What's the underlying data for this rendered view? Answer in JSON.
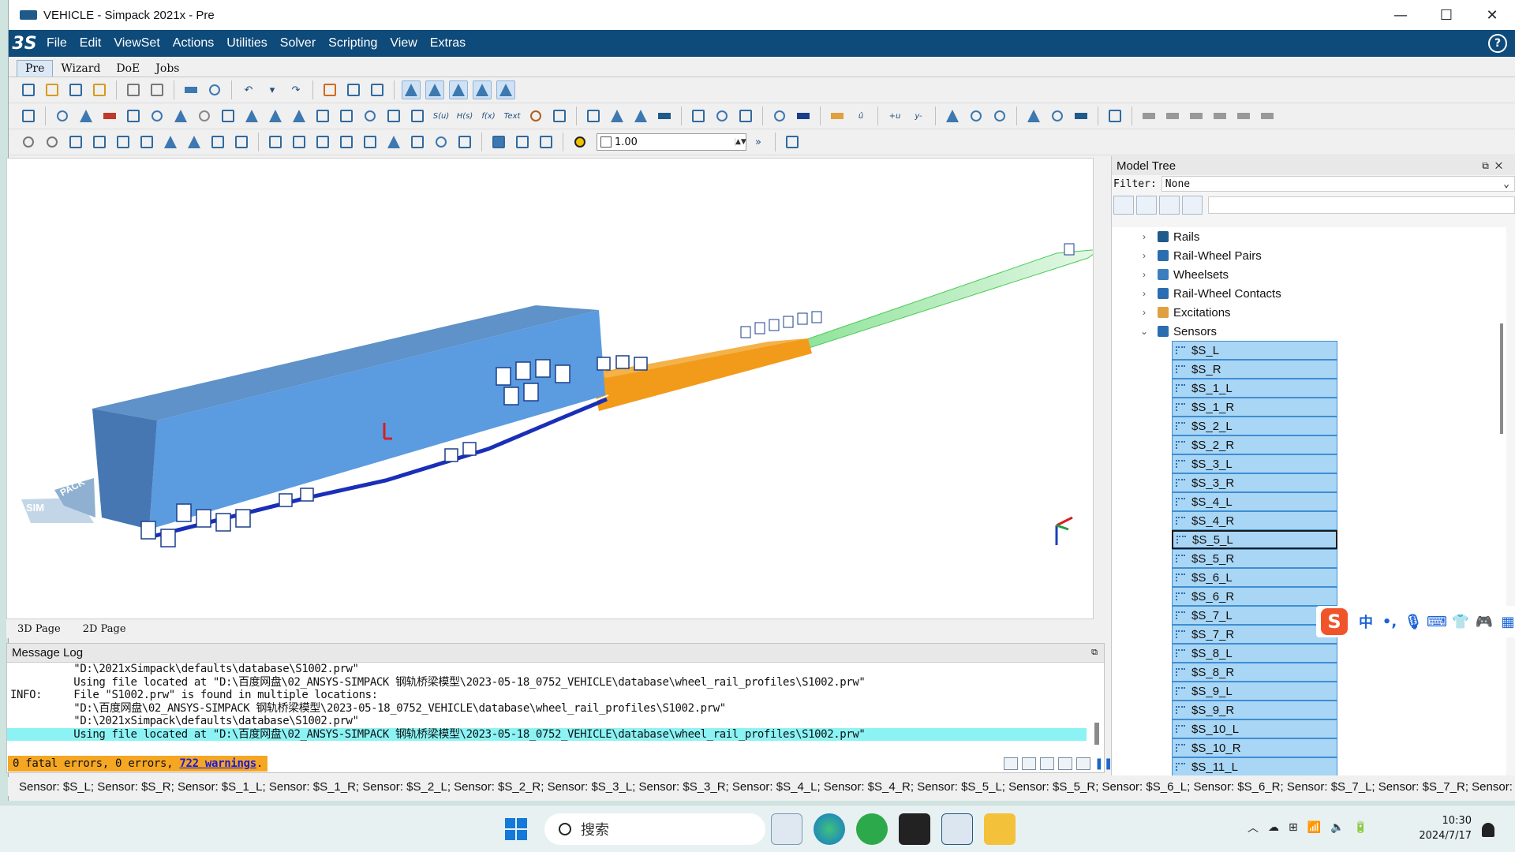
{
  "window": {
    "title": "VEHICLE - Simpack 2021x - Pre",
    "min": "—",
    "max": "☐",
    "close": "✕"
  },
  "menu": {
    "logo": "3S",
    "items": [
      "File",
      "Edit",
      "ViewSet",
      "Actions",
      "Utilities",
      "Solver",
      "Scripting",
      "View",
      "Extras"
    ],
    "help": "?"
  },
  "perspectives": [
    "Pre",
    "Wizard",
    "DoE",
    "Jobs"
  ],
  "toolbar3": {
    "zoom_value": "1.00"
  },
  "page_tabs": [
    "3D Page",
    "2D Page"
  ],
  "viewport": {
    "logo_sim": "SIM",
    "logo_pack": "PACK"
  },
  "message_log": {
    "title": "Message Log",
    "lines": [
      "          \"D:\\2021xSimpack\\defaults\\database\\S1002.prw\"",
      "          Using file located at \"D:\\百度网盘\\02_ANSYS-SIMPACK 钢轨桥梁模型\\2023-05-18_0752_VEHICLE\\database\\wheel_rail_profiles\\S1002.prw\"",
      "INFO:     File \"S1002.prw\" is found in multiple locations:",
      "          \"D:\\百度网盘\\02_ANSYS-SIMPACK 钢轨桥梁模型\\2023-05-18_0752_VEHICLE\\database\\wheel_rail_profiles\\S1002.prw\"",
      "          \"D:\\2021xSimpack\\defaults\\database\\S1002.prw\"",
      "          Using file located at \"D:\\百度网盘\\02_ANSYS-SIMPACK 钢轨桥梁模型\\2023-05-18_0752_VEHICLE\\database\\wheel_rail_profiles\\S1002.prw\""
    ]
  },
  "error_bar": {
    "prefix": "0 fatal errors, 0 errors, ",
    "warnings": "722 warnings",
    "suffix": "."
  },
  "status_bar": "Sensor: $S_L; Sensor: $S_R; Sensor: $S_1_L; Sensor: $S_1_R; Sensor: $S_2_L; Sensor: $S_2_R; Sensor: $S_3_L; Sensor: $S_3_R; Sensor: $S_4_L; Sensor: $S_4_R; Sensor: $S_5_L; Sensor: $S_5_R; Sensor: $S_6_L; Sensor: $S_6_R; Sensor: $S_7_L; Sensor: $S_7_R; Sensor:",
  "model_tree": {
    "title": "Model Tree",
    "filter_label": "Filter:",
    "filter_value": "None",
    "nodes": [
      {
        "label": "Rails",
        "expanded": false,
        "color": "#1f5a8a"
      },
      {
        "label": "Rail-Wheel Pairs",
        "expanded": false,
        "color": "#2a6db0"
      },
      {
        "label": "Wheelsets",
        "expanded": false,
        "color": "#3a7ec0"
      },
      {
        "label": "Rail-Wheel Contacts",
        "expanded": false,
        "color": "#2a6db0"
      },
      {
        "label": "Excitations",
        "expanded": false,
        "color": "#e0a040"
      },
      {
        "label": "Sensors",
        "expanded": true,
        "color": "#2a6db0"
      }
    ],
    "sensors": [
      "$S_L",
      "$S_R",
      "$S_1_L",
      "$S_1_R",
      "$S_2_L",
      "$S_2_R",
      "$S_3_L",
      "$S_3_R",
      "$S_4_L",
      "$S_4_R",
      "$S_5_L",
      "$S_5_R",
      "$S_6_L",
      "$S_6_R",
      "$S_7_L",
      "$S_7_R",
      "$S_8_L",
      "$S_8_R",
      "$S_9_L",
      "$S_9_R",
      "$S_10_L",
      "$S_10_R",
      "$S_11_L"
    ],
    "focused_sensor": "$S_5_L"
  },
  "ime": {
    "logo": "S",
    "mode": "中"
  },
  "taskbar": {
    "search_placeholder": "搜索",
    "time": "10:30",
    "date": "2024/7/17"
  }
}
